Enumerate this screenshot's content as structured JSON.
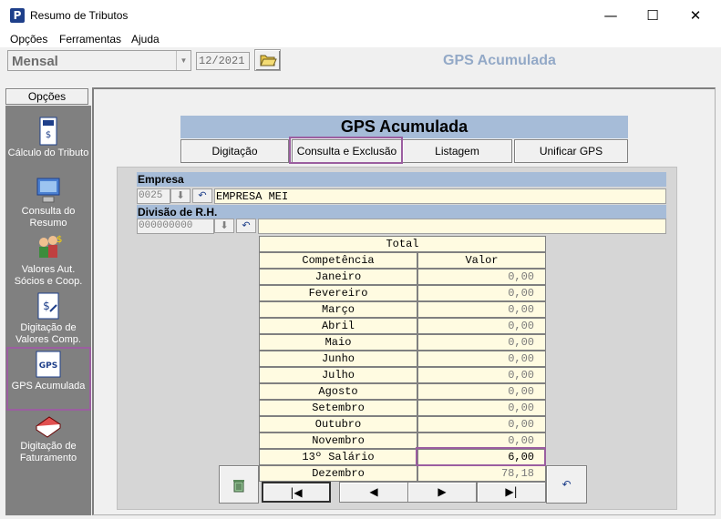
{
  "window": {
    "title": "Resumo de Tributos",
    "app_icon": "P",
    "minimize": "—",
    "maximize": "☐",
    "close": "✕"
  },
  "menu": [
    "Opções",
    "Ferramentas",
    "Ajuda"
  ],
  "toolbar": {
    "period_select": "Mensal",
    "month_input": "12/2021",
    "header_title": "GPS Acumulada"
  },
  "sidebar": {
    "header": "Opções",
    "items": [
      {
        "label": "Cálculo do Tributo",
        "icon": "calculator-doc-icon"
      },
      {
        "label": "Consulta do Resumo",
        "icon": "computer-icon"
      },
      {
        "label": "Valores Aut. Sócios e Coop.",
        "icon": "people-money-icon"
      },
      {
        "label": "Digitação de Valores Comp.",
        "icon": "edit-doc-icon"
      },
      {
        "label": "GPS Acumulada",
        "icon": "gps-icon",
        "selected": true
      },
      {
        "label": "Digitação de Faturamento",
        "icon": "book-icon"
      }
    ]
  },
  "main": {
    "title": "GPS Acumulada",
    "tabs": [
      "Digitação",
      "Consulta e Exclusão",
      "Listagem",
      "Unificar GPS"
    ],
    "active_tab": "Consulta e Exclusão",
    "empresa": {
      "label": "Empresa",
      "code": "0025",
      "name": "EMPRESA MEI"
    },
    "divisao": {
      "label": "Divisão de R.H.",
      "code": "000000000",
      "name": ""
    },
    "grid": {
      "title": "Total",
      "col_month": "Competência",
      "col_value": "Valor",
      "rows": [
        {
          "month": "Janeiro",
          "value": "0,00"
        },
        {
          "month": "Fevereiro",
          "value": "0,00"
        },
        {
          "month": "Março",
          "value": "0,00"
        },
        {
          "month": "Abril",
          "value": "0,00"
        },
        {
          "month": "Maio",
          "value": "0,00"
        },
        {
          "month": "Junho",
          "value": "0,00"
        },
        {
          "month": "Julho",
          "value": "0,00"
        },
        {
          "month": "Agosto",
          "value": "0,00"
        },
        {
          "month": "Setembro",
          "value": "0,00"
        },
        {
          "month": "Outubro",
          "value": "0,00"
        },
        {
          "month": "Novembro",
          "value": "0,00"
        },
        {
          "month": "13º Salário",
          "value": "6,00"
        },
        {
          "month": "Dezembro",
          "value": "78,18"
        }
      ]
    },
    "nav": {
      "first": "|◀",
      "prev": "◀",
      "next": "▶",
      "last": "▶|"
    },
    "highlight_color": "#9b5ea0"
  }
}
